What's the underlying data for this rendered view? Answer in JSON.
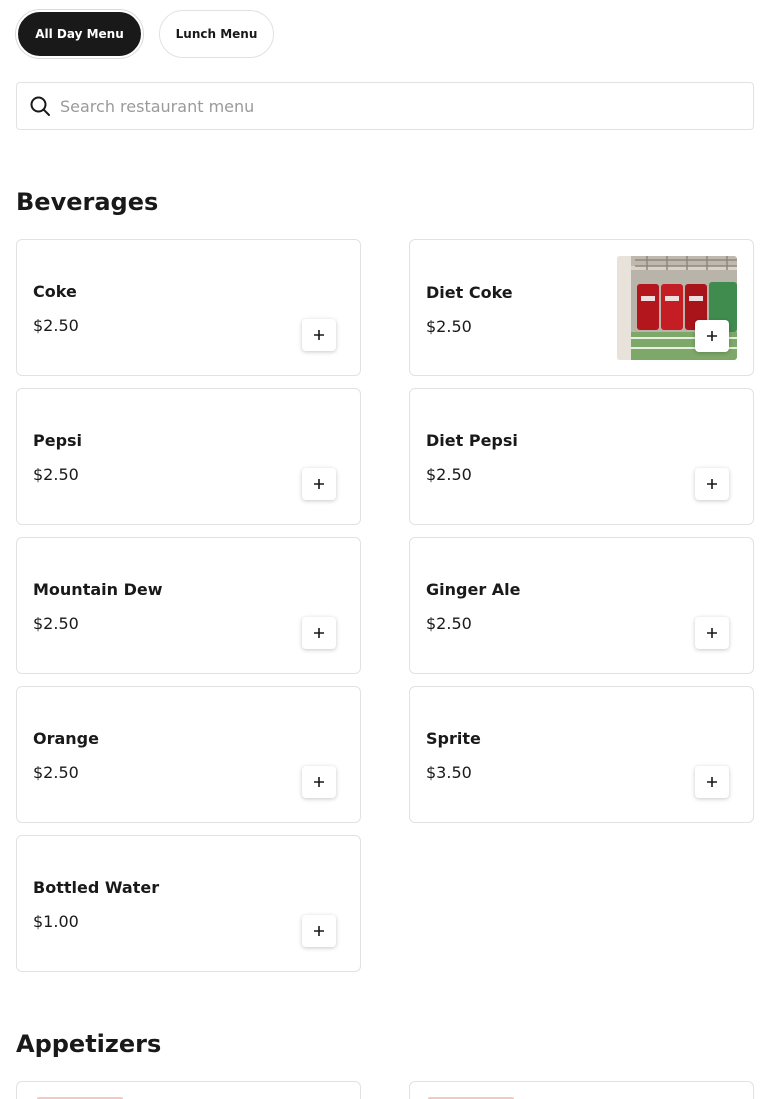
{
  "tabs": [
    {
      "label": "All Day Menu",
      "active": true
    },
    {
      "label": "Lunch Menu",
      "active": false
    }
  ],
  "search": {
    "placeholder": "Search restaurant menu",
    "value": ""
  },
  "sections": [
    {
      "title": "Beverages",
      "items": [
        {
          "name": "Coke",
          "price": "$2.50"
        },
        {
          "name": "Diet Coke",
          "price": "$2.50"
        },
        {
          "name": "Pepsi",
          "price": "$2.50"
        },
        {
          "name": "Diet Pepsi",
          "price": "$2.50"
        },
        {
          "name": "Mountain Dew",
          "price": "$2.50"
        },
        {
          "name": "Ginger Ale",
          "price": "$2.50"
        },
        {
          "name": "Orange",
          "price": "$2.50"
        },
        {
          "name": "Sprite",
          "price": "$3.50"
        },
        {
          "name": "Bottled Water",
          "price": "$1.00"
        }
      ]
    },
    {
      "title": "Appetizers"
    }
  ],
  "icons": {
    "search": "search-icon",
    "add": "plus-icon"
  },
  "colors": {
    "text": "#191919",
    "active_tab_bg": "#191919",
    "border": "#e2e2e2",
    "placeholder": "#9a9a9a"
  }
}
